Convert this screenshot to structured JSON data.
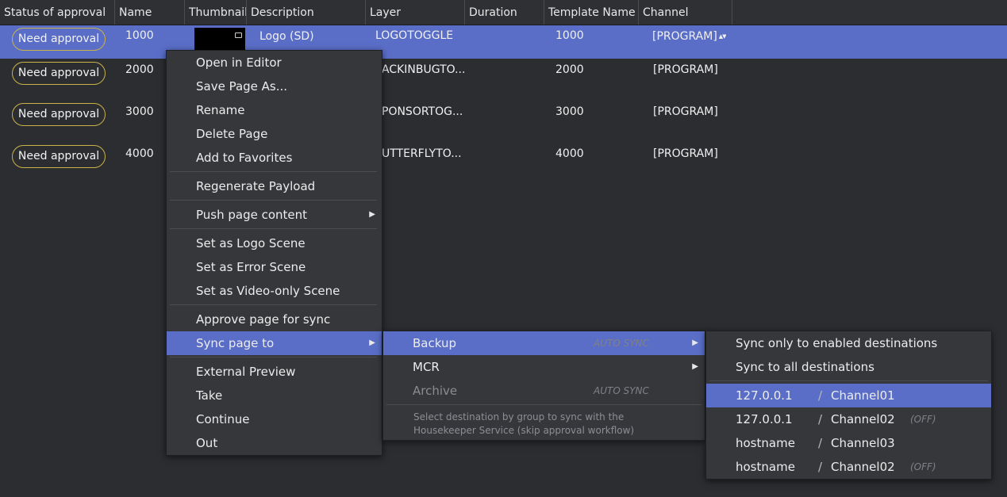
{
  "columns": [
    {
      "label": "Status of approval"
    },
    {
      "label": "Name"
    },
    {
      "label": "Thumbnail"
    },
    {
      "label": "Description"
    },
    {
      "label": "Layer"
    },
    {
      "label": "Duration"
    },
    {
      "label": "Template Name"
    },
    {
      "label": "Channel"
    }
  ],
  "rows": [
    {
      "status": "Need approval",
      "name": "1000",
      "description": "Logo (SD)",
      "layer": "LOGOTOGGLE",
      "template": "1000",
      "channel": "[PROGRAM]",
      "spinner": "▲▼"
    },
    {
      "status": "Need approval",
      "name": "2000",
      "layer": "ACKINBUGTO...",
      "template": "2000",
      "channel": "[PROGRAM]"
    },
    {
      "status": "Need approval",
      "name": "3000",
      "layer": "PONSORTOG...",
      "template": "3000",
      "channel": "[PROGRAM]"
    },
    {
      "status": "Need approval",
      "name": "4000",
      "layer": "UTTERFLYTO...",
      "template": "4000",
      "channel": "[PROGRAM]"
    }
  ],
  "context_menu": {
    "items": [
      "Open in Editor",
      "Save Page As...",
      "Rename",
      "Delete Page",
      "Add to Favorites",
      "Regenerate Payload",
      "Push page content",
      "Set as Logo Scene",
      "Set as Error Scene",
      "Set as Video-only Scene",
      "Approve page for sync",
      "Sync page to",
      "External Preview",
      "Take",
      "Continue",
      "Out"
    ],
    "submenu_arrow": "▶"
  },
  "sync_submenu": {
    "backup": {
      "label": "Backup",
      "tag": "AUTO SYNC"
    },
    "mcr": {
      "label": "MCR"
    },
    "archive": {
      "label": "Archive",
      "tag": "AUTO SYNC"
    },
    "note_line1": "Select destination by group to sync with the",
    "note_line2": "Housekeeper Service (skip approval workflow)"
  },
  "destinations_menu": {
    "sync_enabled": "Sync only to enabled destinations",
    "sync_all": "Sync to all destinations",
    "slash": "/",
    "items": [
      {
        "host": "127.0.0.1",
        "channel": "Channel01",
        "off": ""
      },
      {
        "host": "127.0.0.1",
        "channel": "Channel02",
        "off": "(OFF)"
      },
      {
        "host": "hostname",
        "channel": "Channel03",
        "off": ""
      },
      {
        "host": "hostname",
        "channel": "Channel02",
        "off": "(OFF)"
      }
    ]
  }
}
